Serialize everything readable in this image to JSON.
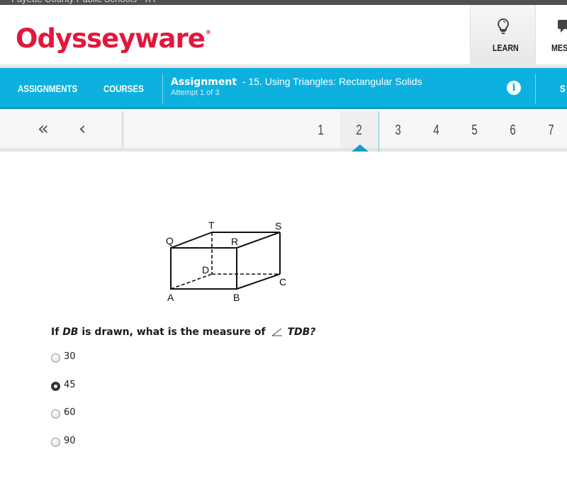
{
  "window": {
    "org_name": "Fayette County Public Schools - KY"
  },
  "brand": {
    "logo_text": "Odysseyware",
    "registered_mark": "®",
    "color": "#e3173e"
  },
  "header_tabs": [
    {
      "label": "LEARN",
      "icon": "lightbulb-icon",
      "active": true
    },
    {
      "label": "MES",
      "icon": "message-bubble-icon",
      "active": false
    }
  ],
  "navbar": {
    "links": [
      "ASSIGNMENTS",
      "COURSES"
    ],
    "assignment_label": "Assignment",
    "assignment_name": "- 15. Using Triangles: Rectangular Solids",
    "attempt": "Attempt 1 of 3",
    "info_icon": "i",
    "cut_off_link": "S",
    "color": "#0db1df"
  },
  "pager": {
    "first_icon": "«",
    "prev_icon": "‹",
    "pages": [
      "1",
      "2",
      "3",
      "4",
      "5",
      "6",
      "7"
    ],
    "current_page": "2"
  },
  "figure": {
    "vertex_labels": {
      "T": "T",
      "S": "S",
      "Q": "Q",
      "R": "R",
      "D": "D",
      "C": "C",
      "A": "A",
      "B": "B"
    }
  },
  "question": {
    "prefix": "If ",
    "segment": "DB",
    "middle": " is drawn, what is the measure of ",
    "angle_name": "TDB?",
    "choices": [
      {
        "label": "30",
        "selected": false
      },
      {
        "label": "45",
        "selected": true
      },
      {
        "label": "60",
        "selected": false
      },
      {
        "label": "90",
        "selected": false
      }
    ]
  }
}
